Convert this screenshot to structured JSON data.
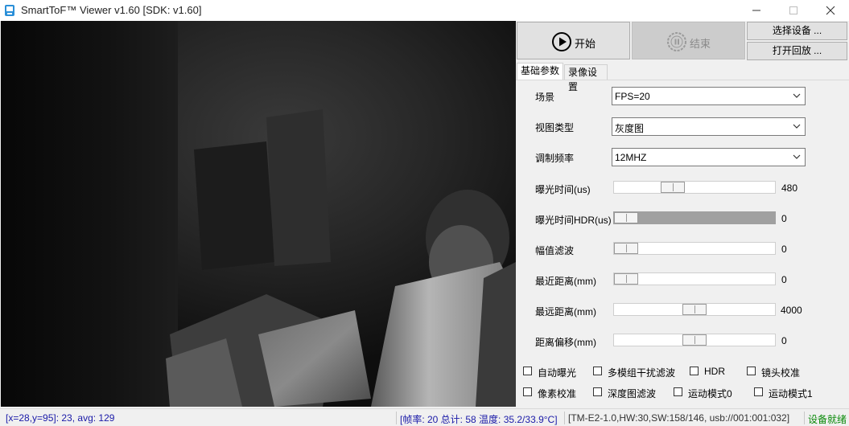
{
  "window": {
    "title": "SmartToF™ Viewer v1.60 [SDK: v1.60]"
  },
  "toolbar": {
    "start_label": "开始",
    "end_label": "结束",
    "select_device_label": "选择设备 ...",
    "open_playback_label": "打开回放 ..."
  },
  "tabs": [
    {
      "label": "基础参数",
      "active": true
    },
    {
      "label": "录像设置",
      "active": false
    }
  ],
  "dropdowns": [
    {
      "label": "场景",
      "value": "FPS=20"
    },
    {
      "label": "视图类型",
      "value": "灰度图"
    },
    {
      "label": "调制频率",
      "value": "12MHZ"
    }
  ],
  "sliders": [
    {
      "label": "曝光时间(us)",
      "value": "480",
      "fraction": 0.34,
      "enabled": true
    },
    {
      "label": "曝光时间HDR(us)",
      "value": "0",
      "fraction": 0.0,
      "enabled": false
    },
    {
      "label": "幅值滤波",
      "value": "0",
      "fraction": 0.0,
      "enabled": true
    },
    {
      "label": "最近距离(mm)",
      "value": "0",
      "fraction": 0.0,
      "enabled": true
    },
    {
      "label": "最远距离(mm)",
      "value": "4000",
      "fraction": 0.5,
      "enabled": true
    },
    {
      "label": "距离偏移(mm)",
      "value": "0",
      "fraction": 0.5,
      "enabled": true
    }
  ],
  "checkboxes": [
    {
      "label": "自动曝光",
      "checked": false
    },
    {
      "label": "多模组干扰滤波",
      "checked": false
    },
    {
      "label": "HDR",
      "checked": false
    },
    {
      "label": "镜头校准",
      "checked": false
    },
    {
      "label": "像素校准",
      "checked": false
    },
    {
      "label": "深度图滤波",
      "checked": false
    },
    {
      "label": "运动模式0",
      "checked": false
    },
    {
      "label": "运动模式1",
      "checked": false
    }
  ],
  "status": {
    "pixel_info": "[x=28,y=95]: 23, avg: 129",
    "frame_info": "[帧率: 20 总计: 58 温度: 35.2/33.9°C]",
    "device_info": "[TM-E2-1.0,HW:30,SW:158/146, usb://001:001:032]",
    "ready": "设备就绪"
  },
  "colors": {
    "status_blue": "#1a1aa8",
    "status_green": "#0a8a0a",
    "camera_background": "#0b0b0b"
  }
}
